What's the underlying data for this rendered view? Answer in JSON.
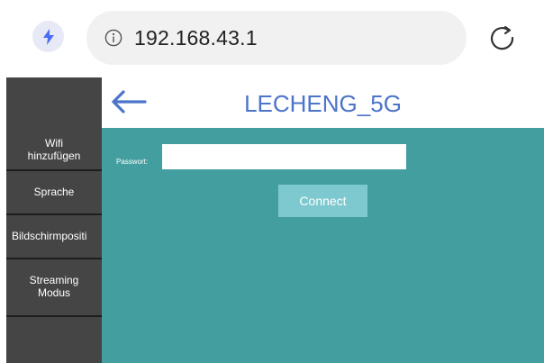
{
  "browser": {
    "url": "192.168.43.1",
    "icons": {
      "bolt": "lightning-bolt-icon",
      "info": "info-icon",
      "reload": "reload-icon"
    }
  },
  "sidebar": {
    "items": [
      {
        "label": "Wifi hinzufügen"
      },
      {
        "label": "Sprache"
      },
      {
        "label": "Bildschirmpositi"
      },
      {
        "label": "Streaming Modus"
      }
    ]
  },
  "header": {
    "title": "LECHENG_5G",
    "back_icon": "back-arrow-icon"
  },
  "form": {
    "password_label": "Passwort:",
    "password_value": "",
    "connect_label": "Connect"
  },
  "colors": {
    "accent": "#4c74c9",
    "sidebar_bg": "#454545",
    "panel_bg": "#439ea0",
    "button_bg": "#7ec9cf"
  }
}
